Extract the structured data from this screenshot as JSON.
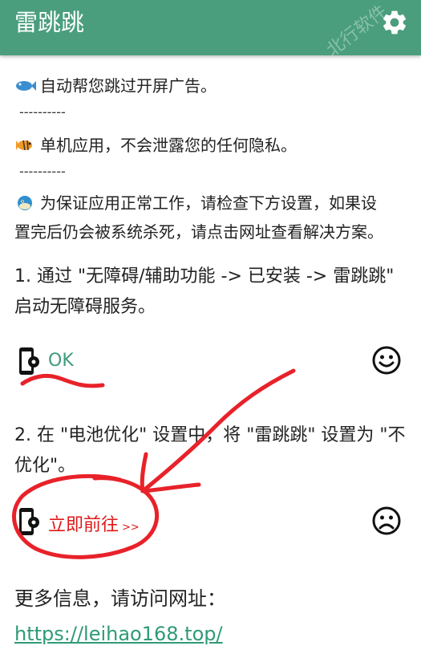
{
  "app": {
    "title": "雷跳跳",
    "watermark": "北行软件"
  },
  "intro": {
    "line1": "自动帮您跳过开屏广告。",
    "separator": "----------",
    "line2": "单机应用，不会泄露您的任何隐私。",
    "line3a": "为保证应用正常工作，请检查下方设置，如果设",
    "line3b": "置完后仍会被系统杀死，请点击网址查看解决方案。"
  },
  "step1": {
    "text": "1. 通过 \"无障碍/辅助功能 -> 已安装 -> 雷跳跳\" 启动无障碍服务。",
    "status": "OK",
    "status_icon": "smiley-icon"
  },
  "step2": {
    "text": "2. 在 \"电池优化\" 设置中，将 \"雷跳跳\" 设置为 \"不优化\"。",
    "action": "立即前往",
    "action_suffix": ">>",
    "status_icon": "frown-icon"
  },
  "footer": {
    "more_info": "更多信息，请访问网址：",
    "url": "https://leihao168.top/"
  },
  "colors": {
    "appbar": "#4a9e7e",
    "ok_green": "#3e9b7c",
    "action_red": "#e01818",
    "annotation_red": "#e8222a"
  }
}
